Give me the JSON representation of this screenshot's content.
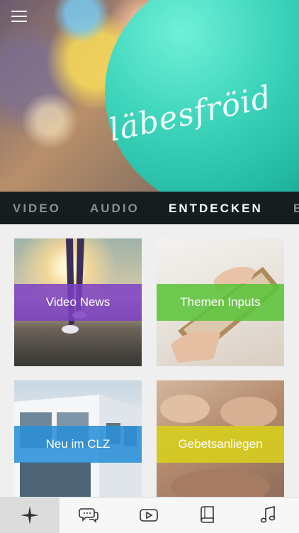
{
  "hero": {
    "balloon_text": "läbesfröid"
  },
  "tabs": [
    {
      "label": "VIDEO",
      "active": false
    },
    {
      "label": "AUDIO",
      "active": false
    },
    {
      "label": "ENTDECKEN",
      "active": true
    },
    {
      "label": "B",
      "active": false
    }
  ],
  "cards": [
    {
      "label": "Video News",
      "band_color": "#7b3fc4"
    },
    {
      "label": "Themen Inputs",
      "band_color": "#5cc43b"
    },
    {
      "label": "Neu im CLZ",
      "band_color": "#2a8fd6"
    },
    {
      "label": "Gebetsanliegen",
      "band_color": "#cfc81f"
    }
  ],
  "bottom_nav": [
    {
      "icon": "sparkle-icon",
      "active": true
    },
    {
      "icon": "chat-icon",
      "active": false
    },
    {
      "icon": "video-play-icon",
      "active": false
    },
    {
      "icon": "book-icon",
      "active": false
    },
    {
      "icon": "music-note-icon",
      "active": false
    }
  ]
}
